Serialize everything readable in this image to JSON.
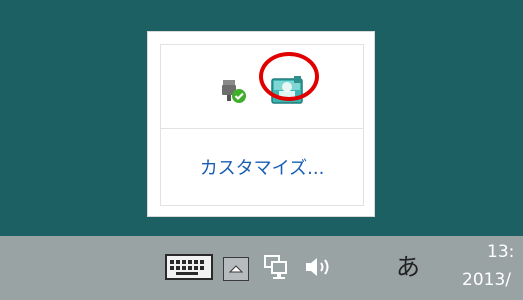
{
  "popup": {
    "customize_label": "カスタマイズ...",
    "icons": [
      "usb-device-icon",
      "app-tray-icon"
    ]
  },
  "taskbar": {
    "ime_label": "あ",
    "clock_time": "13:",
    "clock_date": "2013/",
    "icons": [
      "keyboard-icon",
      "show-hidden-icons-chevron",
      "network-icon",
      "volume-icon"
    ]
  },
  "colors": {
    "desktop": "#1d6063",
    "taskbar": "#9aa3a4",
    "link": "#1a5fb4",
    "highlight": "#e00000"
  }
}
